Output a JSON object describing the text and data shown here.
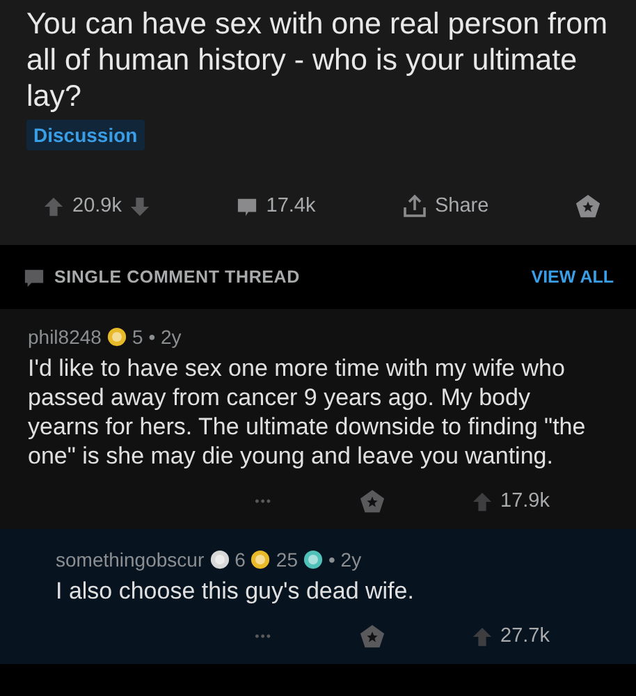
{
  "post": {
    "title": "You can have sex with one real person from all of human history - who is your ultimate lay?",
    "flair": "Discussion",
    "votes": "20.9k",
    "comments": "17.4k",
    "share": "Share"
  },
  "thread_bar": {
    "label": "SINGLE COMMENT THREAD",
    "action": "VIEW ALL"
  },
  "comments": [
    {
      "author": "phil8248",
      "awards": [
        {
          "kind": "gold",
          "count": "5"
        }
      ],
      "age": "• 2y",
      "body": "I'd like to have sex one more time with my wife who passed away from cancer 9 years ago.  My body yearns for hers.  The ultimate downside to finding \"the one\" is she may die young and leave you wanting.",
      "more": "•••",
      "votes": "17.9k",
      "reply": false
    },
    {
      "author": "somethingobscur",
      "awards": [
        {
          "kind": "silver",
          "count": "6"
        },
        {
          "kind": "gold",
          "count": "25"
        },
        {
          "kind": "platinum"
        }
      ],
      "age": "• 2y",
      "body": "I also choose this guy's dead wife.",
      "more": "•••",
      "votes": "27.7k",
      "reply": true
    }
  ]
}
